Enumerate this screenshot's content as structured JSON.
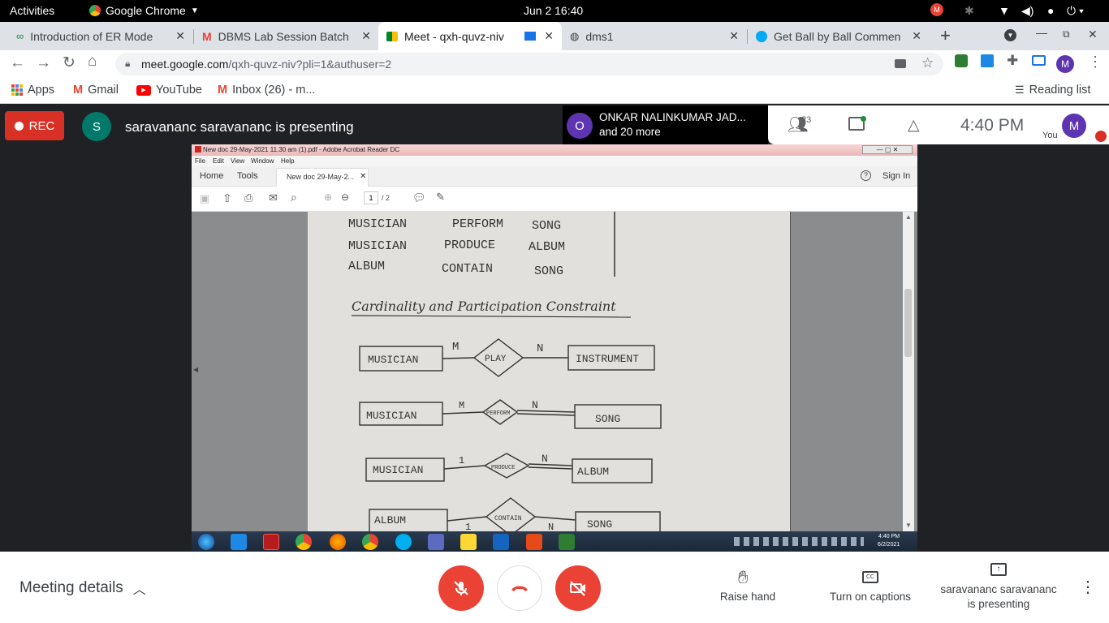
{
  "system_bar": {
    "activities": "Activities",
    "app": "Google Chrome",
    "datetime": "Jun 2  16:40"
  },
  "tabs": [
    {
      "label": "Introduction of ER Mode",
      "icon": "er-model-icon"
    },
    {
      "label": "DBMS Lab Session Batch",
      "icon": "gmail-icon"
    },
    {
      "label": "Meet - qxh-quvz-niv",
      "icon": "meet-icon",
      "active": true
    },
    {
      "label": "dms1",
      "icon": "globe-icon"
    },
    {
      "label": "Get Ball by Ball Commen",
      "icon": "cricket-icon"
    }
  ],
  "url": {
    "host": "meet.google.com",
    "path": "/qxh-quvz-niv?pli=1&authuser=2"
  },
  "bookmarks": {
    "apps": "Apps",
    "gmail": "Gmail",
    "youtube": "YouTube",
    "inbox": "Inbox (26) - m...",
    "reading_list": "Reading list"
  },
  "meet": {
    "rec": "REC",
    "presenter_initial": "S",
    "presenter_text": "saravananc saravananc is presenting",
    "participant_initial": "O",
    "participant_name": "ONKAR NALINKUMAR JAD...",
    "participant_more": "and 20 more",
    "people_count": "23",
    "time": "4:40 PM",
    "you_initial": "M",
    "you_label": "You"
  },
  "acrobat": {
    "title": "New doc 29-May-2021 11.30 am (1).pdf - Adobe Acrobat Reader DC",
    "menu": [
      "File",
      "Edit",
      "View",
      "Window",
      "Help"
    ],
    "home": "Home",
    "tools": "Tools",
    "doc_tab": "New doc 29-May-2...",
    "sign_in": "Sign In",
    "page_current": "1",
    "page_total": "/ 2"
  },
  "note": {
    "rows": [
      [
        "MUSICIAN",
        "PERFORM",
        "SONG"
      ],
      [
        "MUSICIAN",
        "PRODUCE",
        "ALBUM"
      ],
      [
        "ALBUM",
        "CONTAIN",
        "SONG"
      ]
    ],
    "heading": "Cardinality and Participation Constraint",
    "diagram": [
      {
        "left": "MUSICIAN",
        "rel": "PLAY",
        "right": "INSTRUMENT",
        "lc": "M",
        "rc": "N"
      },
      {
        "left": "MUSICIAN",
        "rel": "PERFORM",
        "right": "SONG",
        "lc": "M",
        "rc": "N"
      },
      {
        "left": "MUSICIAN",
        "rel": "PRODUCE",
        "right": "ALBUM",
        "lc": "1",
        "rc": "N"
      },
      {
        "left": "ALBUM",
        "rel": "CONTAIN",
        "right": "SONG",
        "lc": "1",
        "rc": "N"
      }
    ]
  },
  "win_tray": {
    "time": "4:40 PM",
    "date": "6/2/2021"
  },
  "bottom": {
    "details": "Meeting details",
    "raise_hand": "Raise hand",
    "captions": "Turn on captions",
    "presenting_line1": "saravananc saravananc",
    "presenting_line2": "is presenting"
  },
  "colors": {
    "rec_red": "#d93025",
    "end_red": "#ea4335",
    "meet_dark": "#202124",
    "teal": "#00796b",
    "purple": "#5e35b1"
  }
}
